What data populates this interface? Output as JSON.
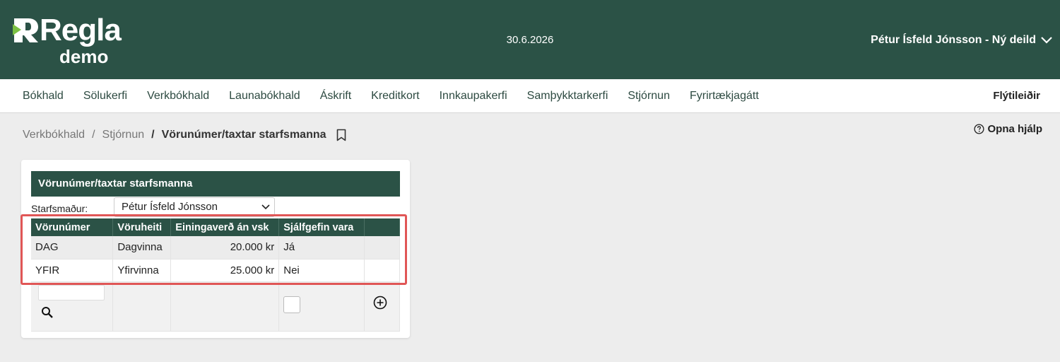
{
  "app": {
    "logo_text": "Regla",
    "logo_sub": "demo",
    "date": "30.6.2026",
    "user": "Pétur Ísfeld Jónsson - Ný deild"
  },
  "nav": {
    "items": [
      {
        "label": "Bókhald"
      },
      {
        "label": "Sölukerfi"
      },
      {
        "label": "Verkbókhald"
      },
      {
        "label": "Launabókhald"
      },
      {
        "label": "Áskrift"
      },
      {
        "label": "Kreditkort"
      },
      {
        "label": "Innkaupakerfi"
      },
      {
        "label": "Samþykktarkerfi"
      },
      {
        "label": "Stjórnun"
      },
      {
        "label": "Fyrirtækjagátt"
      }
    ],
    "shortcuts": "Flýtileiðir"
  },
  "breadcrumb": {
    "items": [
      "Verkbókhald",
      "Stjórnun"
    ],
    "separator": "/",
    "current": "Vörunúmer/taxtar starfsmanna"
  },
  "help": {
    "label": "Opna hjálp"
  },
  "panel": {
    "title": "Vörunúmer/taxtar starfsmanna",
    "employee_label": "Starfsmaður:",
    "employee_value": "Pétur Ísfeld Jónsson"
  },
  "table": {
    "columns": [
      "Vörunúmer",
      "Vöruheiti",
      "Einingaverð án vsk",
      "Sjálfgefin vara",
      ""
    ],
    "rows": [
      {
        "code": "DAG",
        "name": "Dagvinna",
        "price": "20.000 kr",
        "default": "Já"
      },
      {
        "code": "YFIR",
        "name": "Yfirvinna",
        "price": "25.000 kr",
        "default": "Nei"
      }
    ]
  },
  "colors": {
    "brand": "#2b5246",
    "highlight": "#e05656"
  }
}
